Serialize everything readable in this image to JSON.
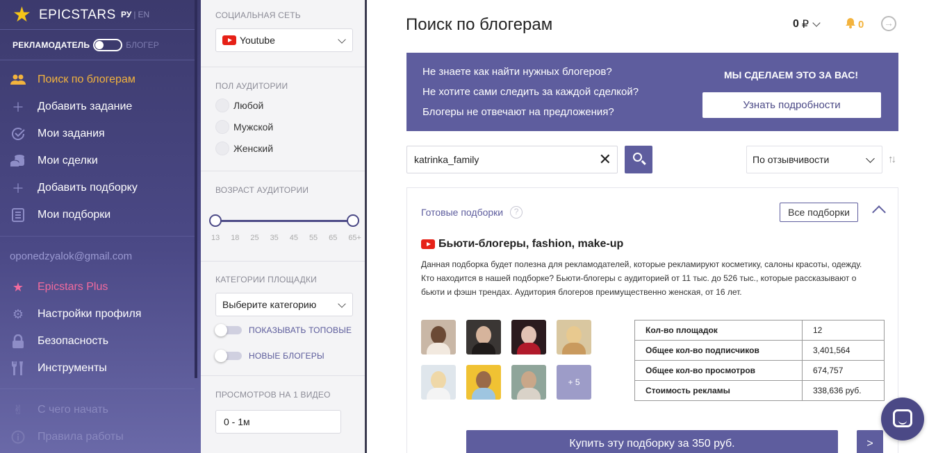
{
  "brand": {
    "name": "EPICSTARS",
    "lang_ru": "РУ",
    "lang_sep": "|",
    "lang_en": "EN"
  },
  "role": {
    "advertiser": "РЕКЛАМОДАТЕЛЬ",
    "blogger": "БЛОГЕР"
  },
  "sidebar": {
    "items": [
      {
        "label": "Поиск по блогерам",
        "icon": "users-icon"
      },
      {
        "label": "Добавить задание",
        "icon": "plus-icon"
      },
      {
        "label": "Мои задания",
        "icon": "check-circle-icon"
      },
      {
        "label": "Мои сделки",
        "icon": "coins-icon"
      },
      {
        "label": "Добавить подборку",
        "icon": "plus-icon"
      },
      {
        "label": "Мои подборки",
        "icon": "list-icon"
      }
    ],
    "email": "oponedzyalok@gmail.com",
    "account": [
      {
        "label": "Epicstars Plus",
        "icon": "star-icon"
      },
      {
        "label": "Настройки профиля",
        "icon": "gear-icon"
      },
      {
        "label": "Безопасность",
        "icon": "lock-icon"
      },
      {
        "label": "Инструменты",
        "icon": "tools-icon"
      }
    ],
    "help": [
      {
        "label": "С чего начать",
        "icon": "victory-hand-icon"
      },
      {
        "label": "Правила работы",
        "icon": "info-icon"
      }
    ]
  },
  "filters": {
    "network": {
      "title": "СОЦИАЛЬНАЯ СЕТЬ",
      "value": "Youtube"
    },
    "gender": {
      "title": "ПОЛ АУДИТОРИИ",
      "options": [
        "Любой",
        "Мужской",
        "Женский"
      ]
    },
    "age": {
      "title": "ВОЗРАСТ АУДИТОРИИ",
      "ticks": [
        "13",
        "18",
        "25",
        "35",
        "45",
        "55",
        "65",
        "65+"
      ],
      "range": [
        "13",
        "65+"
      ]
    },
    "category": {
      "title": "КАТЕГОРИИ ПЛОЩАДКИ",
      "value": "Выберите категорию",
      "show_top": "ПОКАЗЫВАТЬ ТОПОВЫЕ",
      "new_bloggers": "НОВЫЕ БЛОГЕРЫ"
    },
    "views": {
      "title": "ПРОСМОТРОВ НА 1 ВИДЕО",
      "value": "0 - 1м"
    }
  },
  "header": {
    "title": "Поиск по блогерам",
    "balance": "0",
    "currency": "₽",
    "notifications": "0"
  },
  "banner": {
    "questions": [
      "Не знаете как найти нужных блогеров?",
      "Не хотите сами следить за каждой сделкой?",
      "Блогеры не отвечают на предложения?"
    ],
    "cta_title": "МЫ СДЕЛАЕМ ЭТО ЗА ВАС!",
    "cta_button": "Узнать подробности"
  },
  "search": {
    "value": "katrinka_family",
    "sort": "По отзывчивости"
  },
  "collection": {
    "ready_label": "Готовые подборки",
    "all_button": "Все подборки",
    "title": "Бьюти-блогеры, fashion, make-up",
    "description": "Данная подборка будет полезна для рекламодателей, которые рекламируют косметику, салоны красоты, одежду. Кто находится в нашей подборке? Бьюти-блогеры с аудиторией от 11 тыс. до 526 тыс., которые рассказывают о бьюти и фэшн трендах. Аудитория блогеров преимущественно женская, от 16 лет.",
    "more": "+ 5",
    "stats": [
      {
        "key": "Кол-во площадок",
        "value": "12"
      },
      {
        "key": "Общее кол-во подписчиков",
        "value": "3,401,564"
      },
      {
        "key": "Общее кол-во просмотров",
        "value": "674,757"
      },
      {
        "key": "Стоимость рекламы",
        "value": "338,636 руб."
      }
    ],
    "buy_button": "Купить эту подборку за 350 руб.",
    "next_button": ">"
  },
  "colors": {
    "accent": "#5e5d9e",
    "sidebar": "#3c3a6d",
    "active": "#f3b33d",
    "plus": "#f26b9e",
    "youtube": "#e62117"
  }
}
